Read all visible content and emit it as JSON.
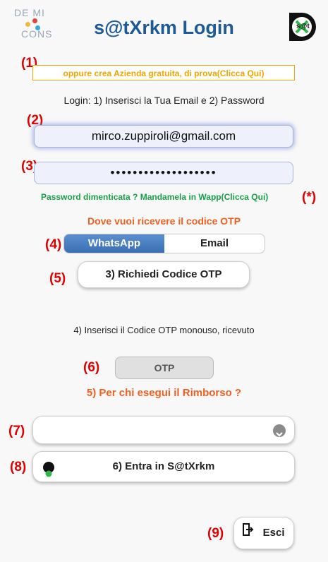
{
  "logos": {
    "left_logo_text_1": "DE MI",
    "left_logo_text_2": "CONS",
    "right_logo_text": "s@t"
  },
  "page_title": "s@tXrkm Login",
  "markers": {
    "m1": "(1)",
    "m2": "(2)",
    "m3": "(3)",
    "m4": "(4)",
    "m5": "(5)",
    "m6": "(6)",
    "m7": "(7)",
    "m8": "(8)",
    "m9": "(9)",
    "star": "(*)"
  },
  "banner_text": "oppure crea Azienda gratuita, di prova(Clicca Qui)",
  "login_instructions": "Login: 1) Inserisci la Tua Email e 2) Password",
  "email_value": "mirco.zuppiroli@gmail.com",
  "password_value": "•••••••••••••••••••",
  "forgot_password": "Password dimenticata ? Mandamela in Wapp(Clicca Qui)",
  "otp_destination_label": "Dove vuoi ricevere il codice OTP",
  "otp_channels": {
    "whatsapp": "WhatsApp",
    "email": "Email",
    "selected": "WhatsApp"
  },
  "request_otp_button": "3) Richiedi Codice OTP",
  "otp_step_label": "4) Inserisci il Codice OTP monouso, ricevuto",
  "otp_placeholder": "OTP",
  "reimbursement_label": "5) Per chi esegui il Rimborso ?",
  "reimbursement_select_value": "",
  "enter_button": "6) Entra in S@tXrkm",
  "exit_button": "Esci",
  "colors": {
    "title": "#1e5a96",
    "accent_orange": "#f06020",
    "banner_orange": "#f0a500",
    "marker_red": "#e00000",
    "link_green": "#1aa04a",
    "whatsapp_active": "#3b6fb4"
  },
  "icons": {
    "select_chevron": "chevron-down-icon",
    "enter": "whatsapp-icon",
    "exit": "exit-icon"
  }
}
